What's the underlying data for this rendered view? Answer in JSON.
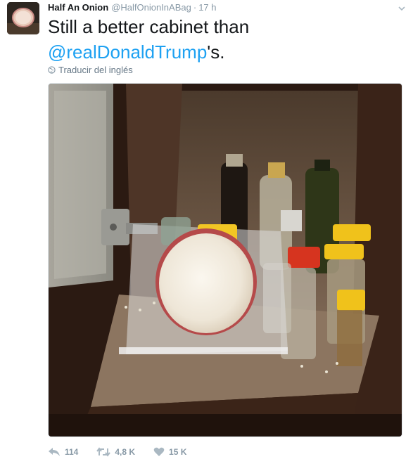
{
  "author": {
    "name": "Half An Onion",
    "handle": "@HalfOnionInABag",
    "separator": "·",
    "time": "17 h"
  },
  "tweet": {
    "text_before": "Still a better cabinet than",
    "mention": "@realDonaldTrump",
    "text_after": "'s."
  },
  "translate": {
    "label": "Traducir del inglés",
    "icon": "globe-icon"
  },
  "photo": {
    "icon": "cabinet-photo"
  },
  "actions": {
    "reply_count": "114",
    "retweet_count": "4,8 K",
    "like_count": "15 K",
    "reply_icon": "reply-icon",
    "retweet_icon": "retweet-icon",
    "like_icon": "heart-icon"
  },
  "colors": {
    "link": "#1da1f2",
    "meta": "#8899a6",
    "text": "#14171a"
  }
}
